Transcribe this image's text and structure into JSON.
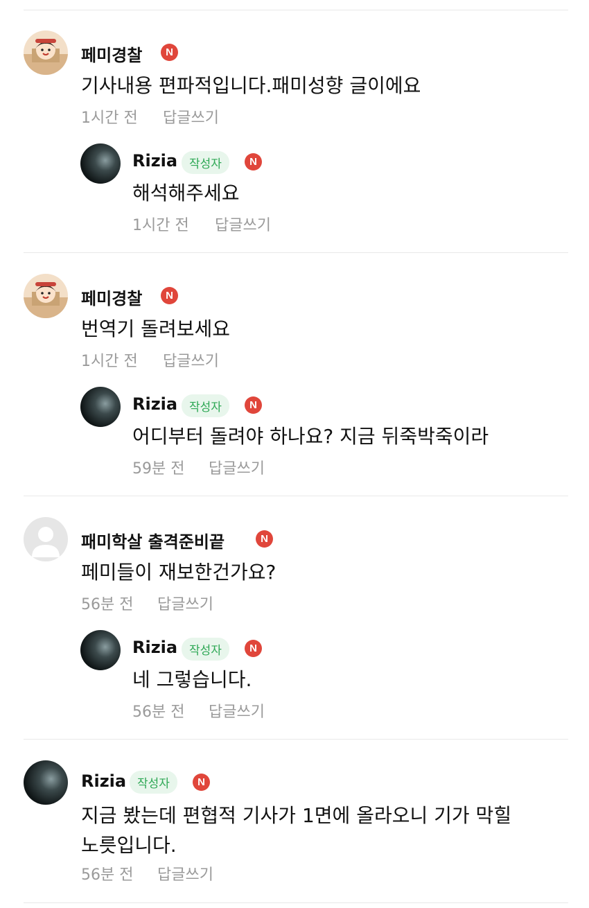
{
  "comments": [
    {
      "name": "페미경찰",
      "text": "기사내용 편파적입니다.패미성향 글이에요",
      "time": "1시간 전",
      "reply_label": "답글쓰기",
      "reply": {
        "name": "Rizia",
        "author_badge": "작성자",
        "text": "해석해주세요",
        "time": "1시간 전",
        "reply_label": "답글쓰기"
      }
    },
    {
      "name": "페미경찰",
      "text": "번역기 돌려보세요",
      "time": "1시간 전",
      "reply_label": "답글쓰기",
      "reply": {
        "name": "Rizia",
        "author_badge": "작성자",
        "text": "어디부터 돌려야 하나요? 지금 뒤죽박죽이라",
        "time": "59분 전",
        "reply_label": "답글쓰기"
      }
    },
    {
      "name": "패미학살 출격준비끝",
      "text": "페미들이 재보한건가요?",
      "time": "56분 전",
      "reply_label": "답글쓰기",
      "reply": {
        "name": "Rizia",
        "author_badge": "작성자",
        "text": "네 그렇습니다.",
        "time": "56분 전",
        "reply_label": "답글쓰기"
      }
    },
    {
      "name": "Rizia",
      "author_badge": "작성자",
      "text_line1": "지금 봤는데 편협적 기사가 1면에 올라오니 기가 막힐",
      "text_line2": "노릇입니다.",
      "time": "56분 전",
      "reply_label": "답글쓰기"
    }
  ],
  "icons": {
    "new_badge": "N",
    "avatar_cartoon": "cartoon-user-avatar",
    "avatar_photo": "photo-avatar",
    "avatar_default": "default-user-avatar"
  },
  "colors": {
    "new_badge": "#e0463b",
    "author_badge_text": "#2ea855",
    "author_badge_bg": "#e8f6ec",
    "meta_text": "#9a9a9a"
  }
}
